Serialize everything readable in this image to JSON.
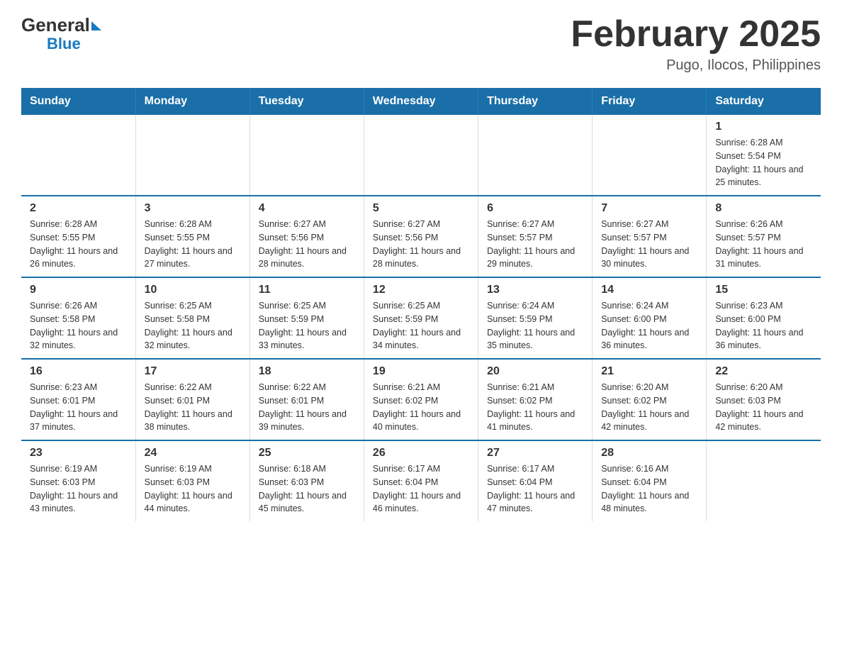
{
  "header": {
    "logo_general": "General",
    "logo_blue": "Blue",
    "title": "February 2025",
    "subtitle": "Pugo, Ilocos, Philippines"
  },
  "days_of_week": [
    "Sunday",
    "Monday",
    "Tuesday",
    "Wednesday",
    "Thursday",
    "Friday",
    "Saturday"
  ],
  "weeks": [
    [
      {
        "day": "",
        "info": ""
      },
      {
        "day": "",
        "info": ""
      },
      {
        "day": "",
        "info": ""
      },
      {
        "day": "",
        "info": ""
      },
      {
        "day": "",
        "info": ""
      },
      {
        "day": "",
        "info": ""
      },
      {
        "day": "1",
        "info": "Sunrise: 6:28 AM\nSunset: 5:54 PM\nDaylight: 11 hours and 25 minutes."
      }
    ],
    [
      {
        "day": "2",
        "info": "Sunrise: 6:28 AM\nSunset: 5:55 PM\nDaylight: 11 hours and 26 minutes."
      },
      {
        "day": "3",
        "info": "Sunrise: 6:28 AM\nSunset: 5:55 PM\nDaylight: 11 hours and 27 minutes."
      },
      {
        "day": "4",
        "info": "Sunrise: 6:27 AM\nSunset: 5:56 PM\nDaylight: 11 hours and 28 minutes."
      },
      {
        "day": "5",
        "info": "Sunrise: 6:27 AM\nSunset: 5:56 PM\nDaylight: 11 hours and 28 minutes."
      },
      {
        "day": "6",
        "info": "Sunrise: 6:27 AM\nSunset: 5:57 PM\nDaylight: 11 hours and 29 minutes."
      },
      {
        "day": "7",
        "info": "Sunrise: 6:27 AM\nSunset: 5:57 PM\nDaylight: 11 hours and 30 minutes."
      },
      {
        "day": "8",
        "info": "Sunrise: 6:26 AM\nSunset: 5:57 PM\nDaylight: 11 hours and 31 minutes."
      }
    ],
    [
      {
        "day": "9",
        "info": "Sunrise: 6:26 AM\nSunset: 5:58 PM\nDaylight: 11 hours and 32 minutes."
      },
      {
        "day": "10",
        "info": "Sunrise: 6:25 AM\nSunset: 5:58 PM\nDaylight: 11 hours and 32 minutes."
      },
      {
        "day": "11",
        "info": "Sunrise: 6:25 AM\nSunset: 5:59 PM\nDaylight: 11 hours and 33 minutes."
      },
      {
        "day": "12",
        "info": "Sunrise: 6:25 AM\nSunset: 5:59 PM\nDaylight: 11 hours and 34 minutes."
      },
      {
        "day": "13",
        "info": "Sunrise: 6:24 AM\nSunset: 5:59 PM\nDaylight: 11 hours and 35 minutes."
      },
      {
        "day": "14",
        "info": "Sunrise: 6:24 AM\nSunset: 6:00 PM\nDaylight: 11 hours and 36 minutes."
      },
      {
        "day": "15",
        "info": "Sunrise: 6:23 AM\nSunset: 6:00 PM\nDaylight: 11 hours and 36 minutes."
      }
    ],
    [
      {
        "day": "16",
        "info": "Sunrise: 6:23 AM\nSunset: 6:01 PM\nDaylight: 11 hours and 37 minutes."
      },
      {
        "day": "17",
        "info": "Sunrise: 6:22 AM\nSunset: 6:01 PM\nDaylight: 11 hours and 38 minutes."
      },
      {
        "day": "18",
        "info": "Sunrise: 6:22 AM\nSunset: 6:01 PM\nDaylight: 11 hours and 39 minutes."
      },
      {
        "day": "19",
        "info": "Sunrise: 6:21 AM\nSunset: 6:02 PM\nDaylight: 11 hours and 40 minutes."
      },
      {
        "day": "20",
        "info": "Sunrise: 6:21 AM\nSunset: 6:02 PM\nDaylight: 11 hours and 41 minutes."
      },
      {
        "day": "21",
        "info": "Sunrise: 6:20 AM\nSunset: 6:02 PM\nDaylight: 11 hours and 42 minutes."
      },
      {
        "day": "22",
        "info": "Sunrise: 6:20 AM\nSunset: 6:03 PM\nDaylight: 11 hours and 42 minutes."
      }
    ],
    [
      {
        "day": "23",
        "info": "Sunrise: 6:19 AM\nSunset: 6:03 PM\nDaylight: 11 hours and 43 minutes."
      },
      {
        "day": "24",
        "info": "Sunrise: 6:19 AM\nSunset: 6:03 PM\nDaylight: 11 hours and 44 minutes."
      },
      {
        "day": "25",
        "info": "Sunrise: 6:18 AM\nSunset: 6:03 PM\nDaylight: 11 hours and 45 minutes."
      },
      {
        "day": "26",
        "info": "Sunrise: 6:17 AM\nSunset: 6:04 PM\nDaylight: 11 hours and 46 minutes."
      },
      {
        "day": "27",
        "info": "Sunrise: 6:17 AM\nSunset: 6:04 PM\nDaylight: 11 hours and 47 minutes."
      },
      {
        "day": "28",
        "info": "Sunrise: 6:16 AM\nSunset: 6:04 PM\nDaylight: 11 hours and 48 minutes."
      },
      {
        "day": "",
        "info": ""
      }
    ]
  ]
}
